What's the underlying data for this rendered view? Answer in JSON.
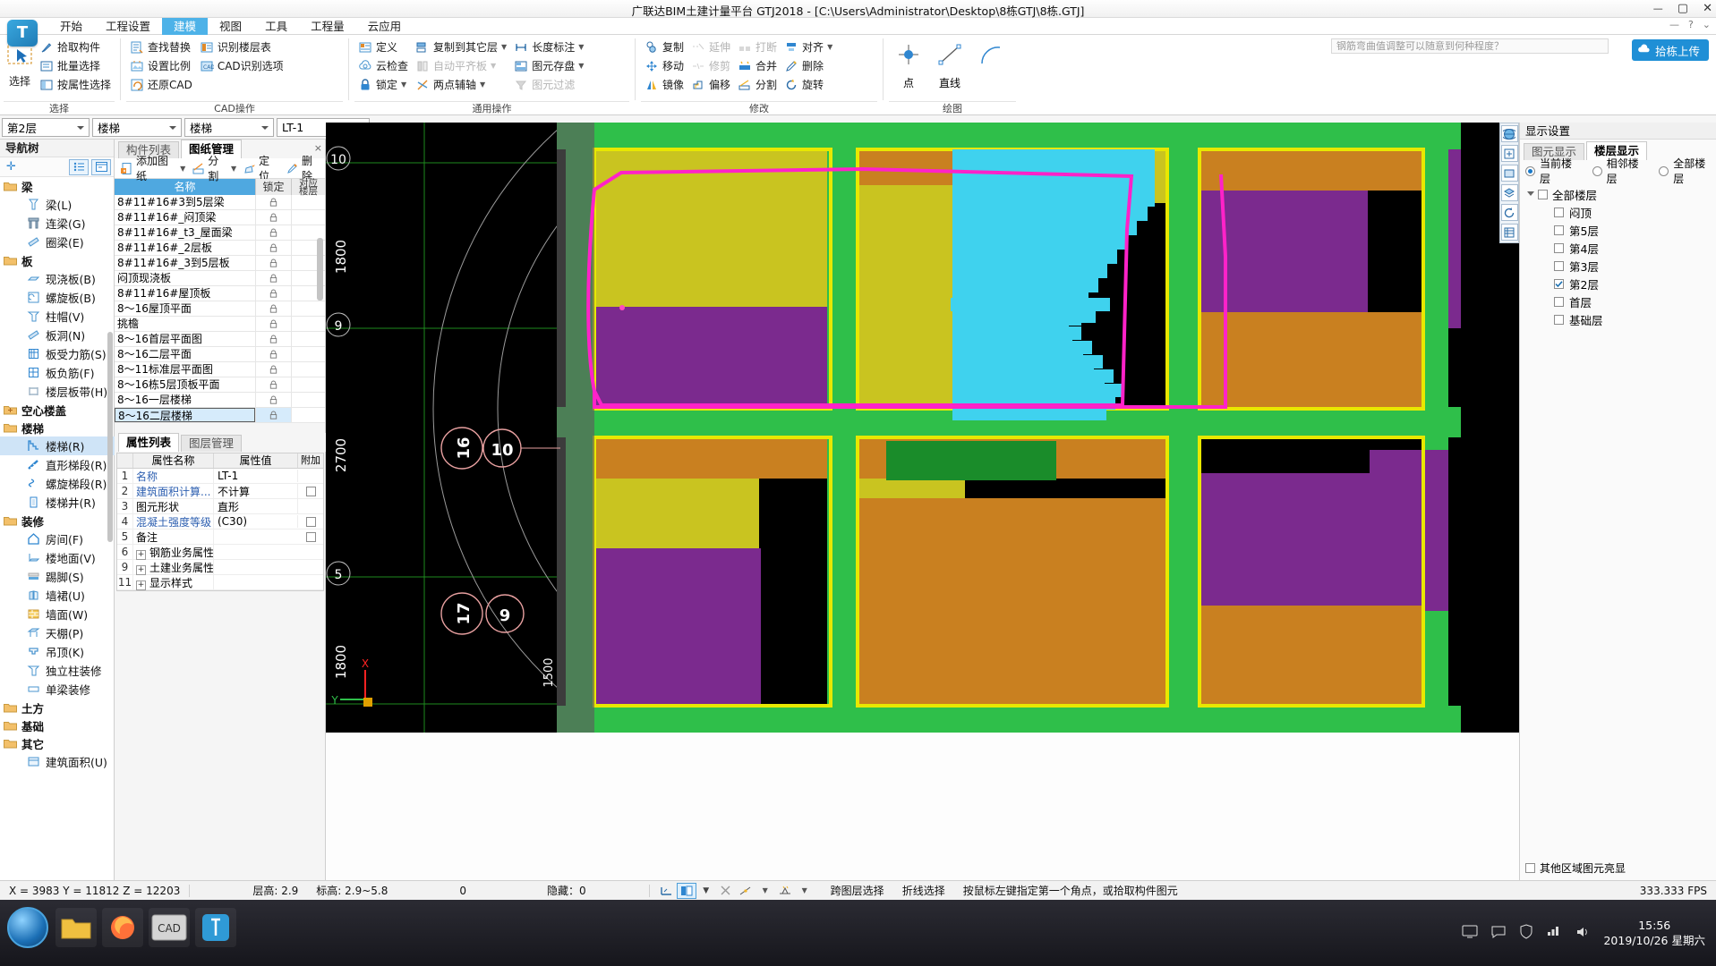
{
  "window": {
    "title": "广联达BIM土建计量平台 GTJ2018 - [C:\\Users\\Administrator\\Desktop\\8栋GTJ\\8栋.GTJ]",
    "minimize": "—",
    "maximize": "▢",
    "close": "✕",
    "help_left": "—",
    "help_q": "?",
    "help_gear": "⌄"
  },
  "menu": {
    "items": [
      {
        "label": "开始",
        "active": false
      },
      {
        "label": "工程设置",
        "active": false
      },
      {
        "label": "建模",
        "active": true
      },
      {
        "label": "视图",
        "active": false
      },
      {
        "label": "工具",
        "active": false
      },
      {
        "label": "工程量",
        "active": false
      },
      {
        "label": "云应用",
        "active": false
      }
    ]
  },
  "ribbon": {
    "hint_placeholder": "钢筋弯曲值调整可以随意到何种程度？",
    "upload_label": "拾栋上传",
    "groups": [
      {
        "label": "选择",
        "big": {
          "label": "选择",
          "icon": "select-cursor-icon"
        },
        "columns": [
          [
            {
              "label": "拾取构件",
              "icon": "picker-icon",
              "disabled": false,
              "caret": false
            },
            {
              "label": "批量选择",
              "icon": "batch-select-icon",
              "disabled": false,
              "caret": false
            },
            {
              "label": "按属性选择",
              "icon": "attr-select-icon",
              "disabled": false,
              "caret": false
            }
          ]
        ]
      },
      {
        "label": "CAD操作",
        "columns": [
          [
            {
              "label": "查找替换",
              "icon": "find-replace-icon",
              "disabled": false,
              "caret": false
            },
            {
              "label": "设置比例",
              "icon": "set-scale-icon",
              "disabled": false,
              "caret": false
            },
            {
              "label": "还原CAD",
              "icon": "restore-cad-icon",
              "disabled": false,
              "caret": false
            }
          ],
          [
            {
              "label": "识别楼层表",
              "icon": "recognize-floor-table-icon",
              "disabled": false,
              "caret": false
            },
            {
              "label": "CAD识别选项",
              "icon": "cad-options-icon",
              "disabled": false,
              "caret": false
            }
          ]
        ]
      },
      {
        "label": "通用操作",
        "columns": [
          [
            {
              "label": "定义",
              "icon": "define-icon",
              "disabled": false,
              "caret": false
            },
            {
              "label": "云检查",
              "icon": "cloud-check-icon",
              "disabled": false,
              "caret": false
            },
            {
              "label": "锁定",
              "icon": "lock-icon",
              "disabled": false,
              "caret": true
            }
          ],
          [
            {
              "label": "复制到其它层",
              "icon": "copy-to-floor-icon",
              "disabled": false,
              "caret": true
            },
            {
              "label": "自动平齐板",
              "icon": "auto-align-slab-icon",
              "disabled": true,
              "caret": true
            },
            {
              "label": "两点辅轴",
              "icon": "two-point-axis-icon",
              "disabled": false,
              "caret": true
            }
          ],
          [
            {
              "label": "长度标注",
              "icon": "length-dim-icon",
              "disabled": false,
              "caret": true
            },
            {
              "label": "图元存盘",
              "icon": "element-save-icon",
              "disabled": false,
              "caret": true
            },
            {
              "label": "图元过滤",
              "icon": "element-filter-icon",
              "disabled": true,
              "caret": false
            }
          ]
        ]
      },
      {
        "label": "修改",
        "columns": [
          [
            {
              "label": "复制",
              "icon": "copy-icon",
              "disabled": false,
              "caret": false
            },
            {
              "label": "移动",
              "icon": "move-icon",
              "disabled": false,
              "caret": false
            },
            {
              "label": "镜像",
              "icon": "mirror-icon",
              "disabled": false,
              "caret": false
            }
          ],
          [
            {
              "label": "延伸",
              "icon": "extend-icon",
              "disabled": true,
              "caret": false
            },
            {
              "label": "修剪",
              "icon": "trim-icon",
              "disabled": true,
              "caret": false
            },
            {
              "label": "偏移",
              "icon": "offset-icon",
              "disabled": false,
              "caret": false
            }
          ],
          [
            {
              "label": "打断",
              "icon": "break-icon",
              "disabled": true,
              "caret": false
            },
            {
              "label": "合并",
              "icon": "merge-icon",
              "disabled": false,
              "caret": false
            },
            {
              "label": "分割",
              "icon": "split-icon",
              "disabled": false,
              "caret": false
            }
          ],
          [
            {
              "label": "对齐",
              "icon": "align-icon",
              "disabled": false,
              "caret": true
            },
            {
              "label": "删除",
              "icon": "delete-icon",
              "disabled": false,
              "caret": false
            },
            {
              "label": "旋转",
              "icon": "rotate-icon",
              "disabled": false,
              "caret": false
            }
          ]
        ]
      },
      {
        "label": "绘图",
        "draw": [
          {
            "label": "点",
            "icon": "point-tool-icon"
          },
          {
            "label": "直线",
            "icon": "line-tool-icon"
          },
          {
            "label": "",
            "icon": "arc-tool-icon"
          }
        ]
      }
    ]
  },
  "selector_bar": {
    "floor": "第2层",
    "category": "楼梯",
    "subcategory": "楼梯",
    "component": "LT-1"
  },
  "nav_tree": {
    "header": "导航树",
    "toolbar": [
      "add-icon",
      "list-view-icon",
      "detail-view-icon"
    ],
    "groups": [
      {
        "label": "梁",
        "expanded": true,
        "items": [
          {
            "label": "梁(L)",
            "icon": "beam-icon"
          },
          {
            "label": "连梁(G)",
            "icon": "coupling-beam-icon"
          },
          {
            "label": "圈梁(E)",
            "icon": "ring-beam-icon"
          }
        ]
      },
      {
        "label": "板",
        "expanded": true,
        "items": [
          {
            "label": "现浇板(B)",
            "icon": "cast-slab-icon"
          },
          {
            "label": "螺旋板(B)",
            "icon": "spiral-slab-icon"
          },
          {
            "label": "柱帽(V)",
            "icon": "column-cap-icon"
          },
          {
            "label": "板洞(N)",
            "icon": "slab-hole-icon"
          },
          {
            "label": "板受力筋(S)",
            "icon": "slab-rebar-icon"
          },
          {
            "label": "板负筋(F)",
            "icon": "slab-neg-rebar-icon"
          },
          {
            "label": "楼层板带(H)",
            "icon": "floor-band-icon"
          }
        ]
      },
      {
        "label": "空心楼盖",
        "expanded": false,
        "items": []
      },
      {
        "label": "楼梯",
        "expanded": true,
        "items": [
          {
            "label": "楼梯(R)",
            "icon": "stair-icon",
            "selected": true
          },
          {
            "label": "直形梯段(R)",
            "icon": "straight-flight-icon"
          },
          {
            "label": "螺旋梯段(R)",
            "icon": "spiral-flight-icon"
          },
          {
            "label": "楼梯井(R)",
            "icon": "stair-well-icon"
          }
        ]
      },
      {
        "label": "装修",
        "expanded": true,
        "items": [
          {
            "label": "房间(F)",
            "icon": "room-icon"
          },
          {
            "label": "楼地面(V)",
            "icon": "floor-finish-icon"
          },
          {
            "label": "踢脚(S)",
            "icon": "skirting-icon"
          },
          {
            "label": "墙裙(U)",
            "icon": "wainscot-icon"
          },
          {
            "label": "墙面(W)",
            "icon": "wall-finish-icon"
          },
          {
            "label": "天棚(P)",
            "icon": "ceiling-icon"
          },
          {
            "label": "吊顶(K)",
            "icon": "suspended-ceiling-icon"
          },
          {
            "label": "独立柱装修",
            "icon": "column-finish-icon"
          },
          {
            "label": "单梁装修",
            "icon": "beam-finish-icon"
          }
        ]
      },
      {
        "label": "土方",
        "expanded": false,
        "items": []
      },
      {
        "label": "基础",
        "expanded": false,
        "items": []
      },
      {
        "label": "其它",
        "expanded": true,
        "items": [
          {
            "label": "建筑面积(U)",
            "icon": "building-area-icon"
          }
        ]
      }
    ]
  },
  "mid_panel": {
    "tabs": [
      {
        "label": "构件列表",
        "active": false
      },
      {
        "label": "图纸管理",
        "active": true
      }
    ],
    "close": "×",
    "toolbar": [
      {
        "label": "添加图纸",
        "icon": "add-drawing-icon",
        "caret": true
      },
      {
        "label": "分割",
        "icon": "split-drawing-icon",
        "caret": true
      },
      {
        "label": "定位",
        "icon": "locate-icon",
        "caret": false
      },
      {
        "label": "删除",
        "icon": "delete-drawing-icon",
        "caret": false
      }
    ],
    "grid": {
      "columns": [
        "名称",
        "锁定",
        "对应楼层"
      ],
      "rows": [
        {
          "name": "8#11#16#3到5层梁",
          "locked": true,
          "selected": false
        },
        {
          "name": "8#11#16#_闷顶梁",
          "locked": true,
          "selected": false
        },
        {
          "name": "8#11#16#_t3_屋面梁",
          "locked": true,
          "selected": false
        },
        {
          "name": "8#11#16#_2层板",
          "locked": true,
          "selected": false
        },
        {
          "name": "8#11#16#_3到5层板",
          "locked": true,
          "selected": false
        },
        {
          "name": "闷顶现浇板",
          "locked": true,
          "selected": false
        },
        {
          "name": "8#11#16#屋顶板",
          "locked": true,
          "selected": false
        },
        {
          "name": "8～16屋顶平面",
          "locked": true,
          "selected": false
        },
        {
          "name": "挑檐",
          "locked": true,
          "selected": false
        },
        {
          "name": "8～16首层平面图",
          "locked": true,
          "selected": false
        },
        {
          "name": "8～16二层平面",
          "locked": true,
          "selected": false
        },
        {
          "name": "8～11标准层平面图",
          "locked": true,
          "selected": false
        },
        {
          "name": "8～16栋5层顶板平面",
          "locked": true,
          "selected": false
        },
        {
          "name": "8～16一层楼梯",
          "locked": true,
          "selected": false
        },
        {
          "name": "8～16二层楼梯",
          "locked": true,
          "selected": true
        }
      ]
    },
    "property_tabs": [
      {
        "label": "属性列表",
        "active": true
      },
      {
        "label": "图层管理",
        "active": false
      }
    ],
    "property_grid": {
      "columns": [
        "",
        "属性名称",
        "属性值",
        "附加"
      ],
      "rows": [
        {
          "num": "1",
          "name": "名称",
          "value": "LT-1",
          "blue": true,
          "checkbox": false
        },
        {
          "num": "2",
          "name": "建筑面积计算...",
          "value": "不计算",
          "blue": true,
          "checkbox": true,
          "checked": false
        },
        {
          "num": "3",
          "name": "图元形状",
          "value": "直形",
          "blue": false,
          "checkbox": false
        },
        {
          "num": "4",
          "name": "混凝土强度等级",
          "value": "(C30)",
          "blue": true,
          "checkbox": true,
          "checked": false
        },
        {
          "num": "5",
          "name": "备注",
          "value": "",
          "blue": false,
          "checkbox": true,
          "checked": false
        },
        {
          "num": "6",
          "name": "钢筋业务属性",
          "value": "",
          "blue": false,
          "checkbox": false,
          "expander": "+"
        },
        {
          "num": "9",
          "name": "土建业务属性",
          "value": "",
          "blue": false,
          "checkbox": false,
          "expander": "+"
        },
        {
          "num": "11",
          "name": "显示样式",
          "value": "",
          "blue": false,
          "checkbox": false,
          "expander": "+"
        }
      ]
    }
  },
  "canvas": {
    "axis_labels_left": [
      "10",
      "9",
      "5"
    ],
    "dims_left": [
      "1800",
      "2700",
      "1800"
    ],
    "dim_vertical": "1500",
    "grid_tags": [
      "16",
      "10",
      "17",
      "9"
    ],
    "axis_indicator": {
      "x": "X",
      "y": "Y"
    },
    "right_tools": [
      "globe-icon",
      "pan-icon",
      "zoom-window-icon",
      "layers-icon",
      "rotate-view-icon",
      "measure-icon"
    ]
  },
  "right_panel": {
    "header": "显示设置",
    "tabs": [
      {
        "label": "图元显示",
        "active": false
      },
      {
        "label": "楼层显示",
        "active": true
      }
    ],
    "radios": [
      {
        "label": "当前楼层",
        "checked": true
      },
      {
        "label": "相邻楼层",
        "checked": false
      },
      {
        "label": "全部楼层",
        "checked": false
      }
    ],
    "tree_root": {
      "label": "全部楼层",
      "checked": false
    },
    "floors": [
      {
        "label": "闷顶",
        "checked": false
      },
      {
        "label": "第5层",
        "checked": false
      },
      {
        "label": "第4层",
        "checked": false
      },
      {
        "label": "第3层",
        "checked": false
      },
      {
        "label": "第2层",
        "checked": true
      },
      {
        "label": "首层",
        "checked": false
      },
      {
        "label": "基础层",
        "checked": false
      }
    ],
    "bottom_option": {
      "label": "其他区域图元亮显",
      "checked": false
    }
  },
  "status_bar": {
    "coords": "X = 3983 Y = 11812 Z = 12203",
    "floor_height": "层高: 2.9",
    "elevation": "标高: 2.9~5.8",
    "zero": "0",
    "hidden": "隐藏：0",
    "mode_buttons": [
      "snap-icon",
      "ortho-icon",
      "grid-icon",
      "polar-icon",
      "object-snap-icon",
      "dyn-input-icon"
    ],
    "cross_layer": "跨图层选择",
    "polyline": "折线选择",
    "prompt": "按鼠标左键指定第一个角点，或拾取构件图元",
    "fps": "333.333 FPS"
  },
  "taskbar": {
    "apps": [
      "folder-icon",
      "firefox-icon",
      "cad-icon",
      "gtj-icon"
    ],
    "tray": [
      "monitor-icon",
      "chat-icon",
      "shield-icon",
      "network-icon",
      "volume-icon"
    ],
    "time": "15:56",
    "date": "2019/10/26 星期六"
  }
}
